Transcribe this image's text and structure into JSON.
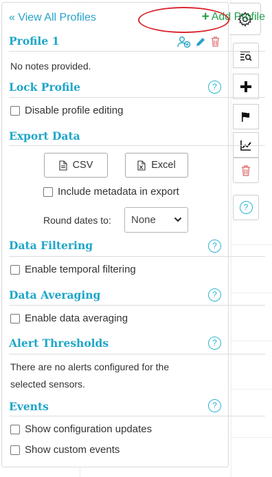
{
  "header": {
    "view_all": "« View All Profiles",
    "add_profile": "Add Profile"
  },
  "profile": {
    "name": "Profile 1",
    "notes": "No notes provided."
  },
  "lock": {
    "title": "Lock Profile",
    "disable_label": "Disable profile editing"
  },
  "export": {
    "title": "Export Data",
    "csv_label": "CSV",
    "excel_label": "Excel",
    "metadata_label": "Include metadata in export",
    "round_label": "Round dates to:",
    "round_value": "None"
  },
  "filtering": {
    "title": "Data Filtering",
    "label": "Enable temporal filtering"
  },
  "averaging": {
    "title": "Data Averaging",
    "label": "Enable data averaging"
  },
  "alerts": {
    "title": "Alert Thresholds",
    "message_line1": "There are no alerts configured for the",
    "message_line2": "selected sensors."
  },
  "events": {
    "title": "Events",
    "config_label": "Show configuration updates",
    "custom_label": "Show custom events"
  },
  "help_glyph": "?",
  "colors": {
    "accent": "#1ea6c8",
    "add_green": "#21a04a",
    "delete_red": "#e07b7b",
    "highlight_red": "#d9262e"
  },
  "icons": [
    "settings-icon",
    "search-list-icon",
    "plus-icon",
    "flag-icon",
    "line-chart-icon",
    "trash-icon",
    "help-icon",
    "add-user-icon",
    "pencil-icon",
    "csv-file-icon",
    "excel-file-icon"
  ]
}
